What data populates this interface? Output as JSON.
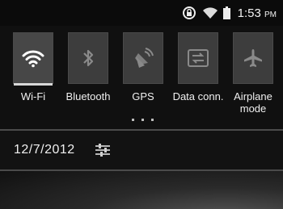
{
  "status": {
    "time": "1:53",
    "ampm": "PM"
  },
  "tiles": [
    {
      "label": "Wi-Fi",
      "icon": "wifi-icon",
      "active": true
    },
    {
      "label": "Bluetooth",
      "icon": "bluetooth-icon",
      "active": false
    },
    {
      "label": "GPS",
      "icon": "gps-icon",
      "active": false
    },
    {
      "label": "Data conn.",
      "icon": "data-connection-icon",
      "active": false
    },
    {
      "label": "Airplane",
      "label2": "mode",
      "icon": "airplane-icon",
      "active": false
    }
  ],
  "date": "12/7/2012",
  "colors": {
    "tile_bg": "#3d3d3d",
    "indicator": "#d8d8d8"
  }
}
